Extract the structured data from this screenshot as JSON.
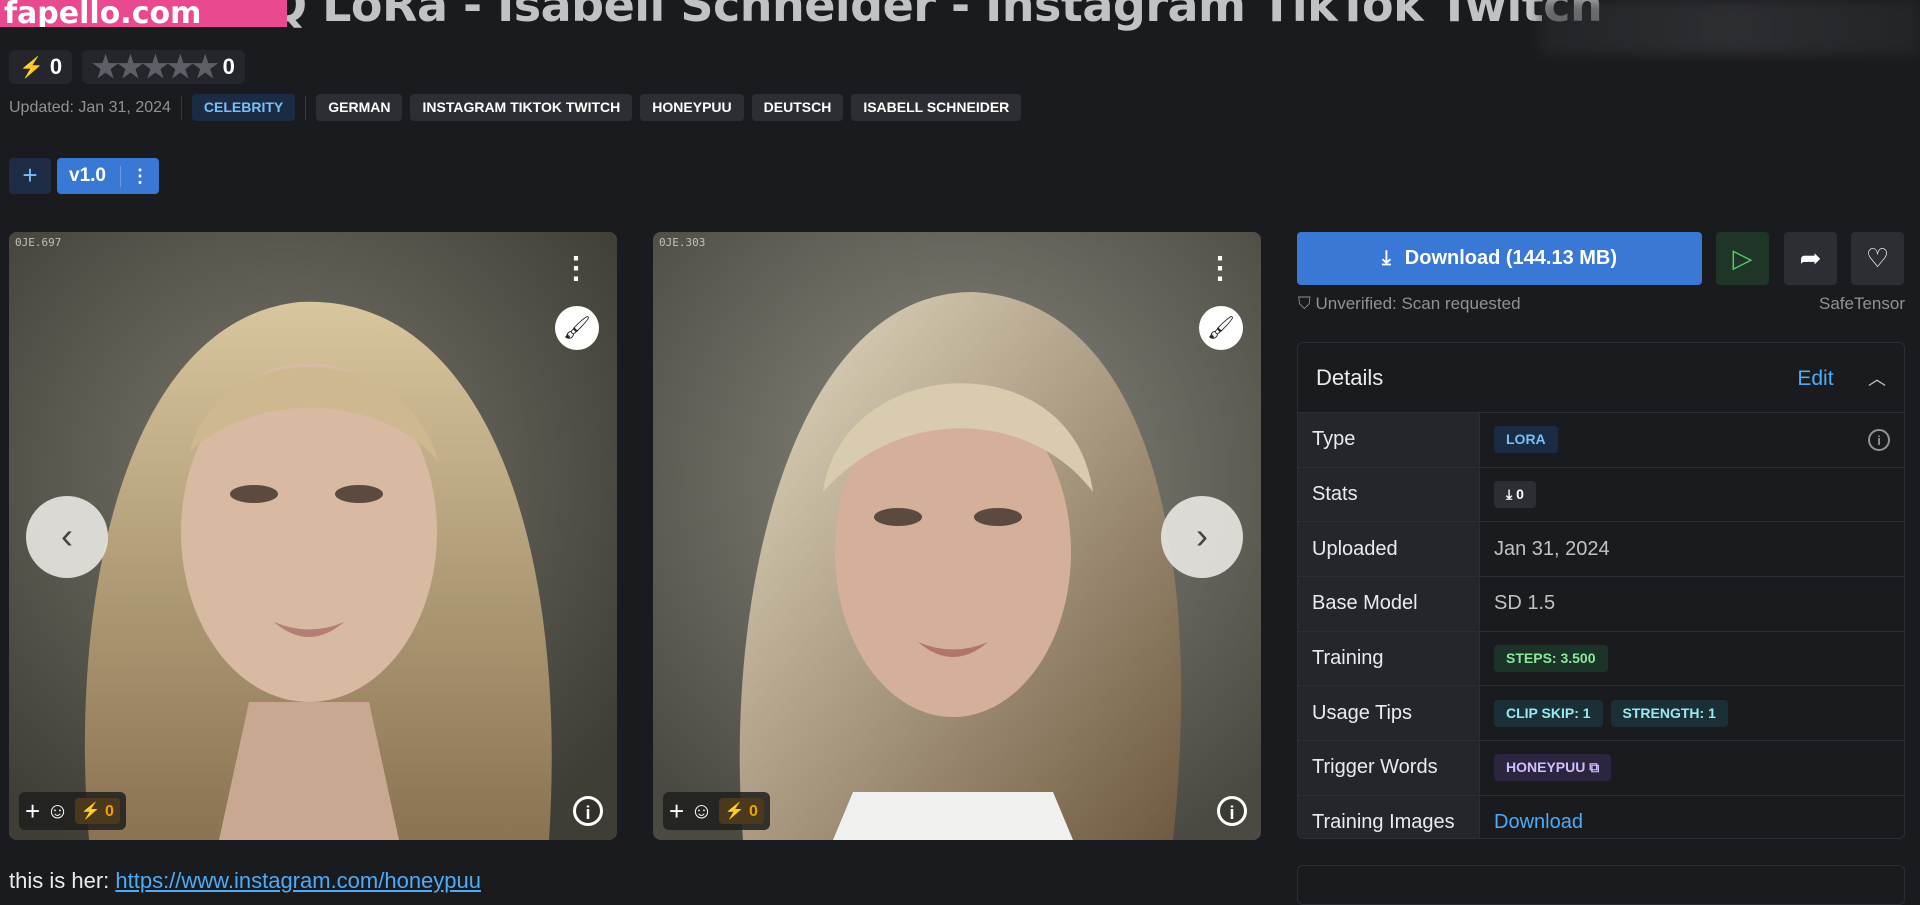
{
  "page": {
    "title": "HQ LoRa - Isabell Schneider - Instagram TikTok Twitch",
    "watermark": "fapello.com"
  },
  "rating": {
    "buzz_count": "0",
    "stars": "★★★★★",
    "review_count": "0"
  },
  "meta": {
    "updated": "Updated: Jan 31, 2024",
    "tags": [
      "CELEBRITY",
      "GERMAN",
      "INSTAGRAM TIKTOK TWITCH",
      "HONEYPUU",
      "DEUTSCH",
      "ISABELL SCHNEIDER"
    ]
  },
  "version": {
    "add": "+",
    "label": "v1.0",
    "menu": "⋮"
  },
  "gallery": {
    "images": [
      {
        "code": "0JE.697",
        "reaction_count": "0"
      },
      {
        "code": "0JE.303",
        "reaction_count": "0"
      }
    ],
    "prev": "‹",
    "next": "›"
  },
  "download": {
    "label": "Download (144.13 MB)",
    "scan_status": "Unverified: Scan requested",
    "format": "SafeTensor"
  },
  "details": {
    "heading": "Details",
    "edit": "Edit",
    "rows": {
      "type": {
        "label": "Type",
        "value": "LORA"
      },
      "stats": {
        "label": "Stats",
        "value": "0"
      },
      "uploaded": {
        "label": "Uploaded",
        "value": "Jan 31, 2024"
      },
      "base_model": {
        "label": "Base Model",
        "value": "SD 1.5"
      },
      "training": {
        "label": "Training",
        "value": "STEPS: 3.500"
      },
      "usage_tips": {
        "label": "Usage Tips",
        "clip_skip": "CLIP SKIP: 1",
        "strength": "STRENGTH: 1"
      },
      "trigger_words": {
        "label": "Trigger Words",
        "value": "HONEYPUU"
      },
      "training_images": {
        "label": "Training Images",
        "value": "Download"
      }
    }
  },
  "description": {
    "prefix": "this is her: ",
    "link": "https://www.instagram.com/honeypuu"
  },
  "colors": {
    "accent": "#3a78d6",
    "link": "#4dabf7",
    "background": "#1a1b1e"
  }
}
